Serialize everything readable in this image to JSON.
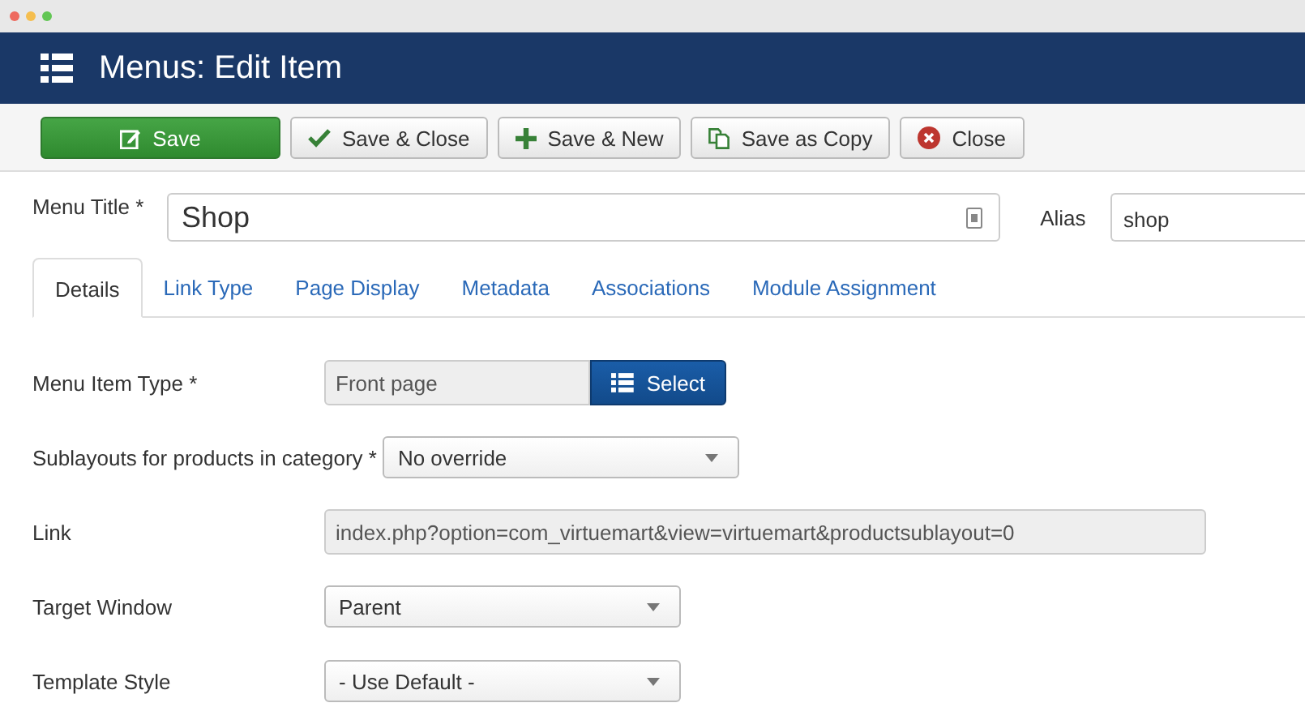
{
  "window": {
    "title": "Menus: Edit Item"
  },
  "toolbar": [
    {
      "label": "Save",
      "kind": "save"
    },
    {
      "label": "Save & Close",
      "kind": "saveclose"
    },
    {
      "label": "Save & New",
      "kind": "savenew"
    },
    {
      "label": "Save as Copy",
      "kind": "savecopy"
    },
    {
      "label": "Close",
      "kind": "close"
    }
  ],
  "title_field": {
    "label": "Menu Title *",
    "value": "Shop"
  },
  "alias_field": {
    "label": "Alias",
    "value": "shop"
  },
  "tabs": [
    {
      "label": "Details",
      "selected": true
    },
    {
      "label": "Link Type",
      "selected": false
    },
    {
      "label": "Page Display",
      "selected": false
    },
    {
      "label": "Metadata",
      "selected": false
    },
    {
      "label": "Associations",
      "selected": false
    },
    {
      "label": "Module Assignment",
      "selected": false
    }
  ],
  "fields": [
    {
      "kind": "picker",
      "label": "Menu Item Type *",
      "value": "Front page",
      "button": "Select"
    },
    {
      "kind": "select",
      "label": "Sublayouts for products in category *",
      "value": "No override"
    },
    {
      "kind": "readonly",
      "label": "Link",
      "value": "index.php?option=com_virtuemart&view=virtuemart&productsublayout=0"
    },
    {
      "kind": "select",
      "label": "Target Window",
      "value": "Parent"
    },
    {
      "kind": "select",
      "label": "Template Style",
      "value": "- Use Default -"
    }
  ]
}
